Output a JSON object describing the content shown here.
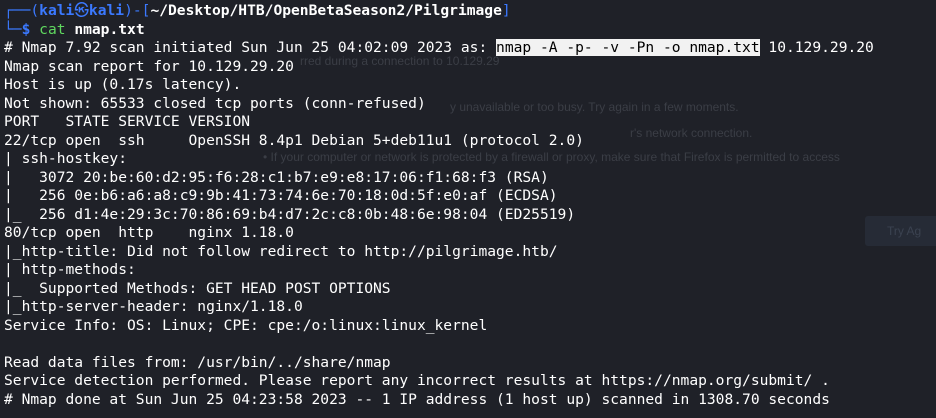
{
  "prompt": {
    "corner_top": "┌──",
    "user": "kali",
    "at": "㉿",
    "host": "kali",
    "sep": ")-[",
    "open_paren": "(",
    "cwd": "~/Desktop/HTB/OpenBetaSeason2/Pilgrimage",
    "close_bracket": "]",
    "corner_bottom": "└─",
    "dollar": "$",
    "command_name": "cat",
    "command_arg": "nmap.txt"
  },
  "output": {
    "line1_prefix": "# Nmap 7.92 scan initiated Sun Jun 25 04:02:09 2023 as: ",
    "line1_highlight": "nmap -A -p- -v -Pn -o nmap.txt",
    "line1_suffix": " 10.129.29.20",
    "lines": [
      "Nmap scan report for 10.129.29.20",
      "Host is up (0.17s latency).",
      "Not shown: 65533 closed tcp ports (conn-refused)",
      "PORT   STATE SERVICE VERSION",
      "22/tcp open  ssh     OpenSSH 8.4p1 Debian 5+deb11u1 (protocol 2.0)",
      "| ssh-hostkey: ",
      "|   3072 20:be:60:d2:95:f6:28:c1:b7:e9:e8:17:06:f1:68:f3 (RSA)",
      "|   256 0e:b6:a6:a8:c9:9b:41:73:74:6e:70:18:0d:5f:e0:af (ECDSA)",
      "|_  256 d1:4e:29:3c:70:86:69:b4:d7:2c:c8:0b:48:6e:98:04 (ED25519)",
      "80/tcp open  http    nginx 1.18.0",
      "|_http-title: Did not follow redirect to http://pilgrimage.htb/",
      "| http-methods: ",
      "|_  Supported Methods: GET HEAD POST OPTIONS",
      "|_http-server-header: nginx/1.18.0",
      "Service Info: OS: Linux; CPE: cpe:/o:linux:linux_kernel",
      "",
      "Read data files from: /usr/bin/../share/nmap",
      "Service detection performed. Please report any incorrect results at https://nmap.org/submit/ .",
      "# Nmap done at Sun Jun 25 04:23:58 2023 -- 1 IP address (1 host up) scanned in 1308.70 seconds"
    ]
  },
  "background_ghost": {
    "text1": "rred during a connection to 10.129.29",
    "text2": "y unavailable or too busy. Try again in a few moments.",
    "text3": "r's network connection.",
    "text4": "• If your computer or network is protected by a firewall or proxy, make sure that Firefox is permitted to access",
    "button": "Try Ag"
  },
  "colors": {
    "background": "#1f2128",
    "prompt_blue": "#3b79ff",
    "text": "#ffffff",
    "highlight_bg": "#f2f2f2"
  }
}
